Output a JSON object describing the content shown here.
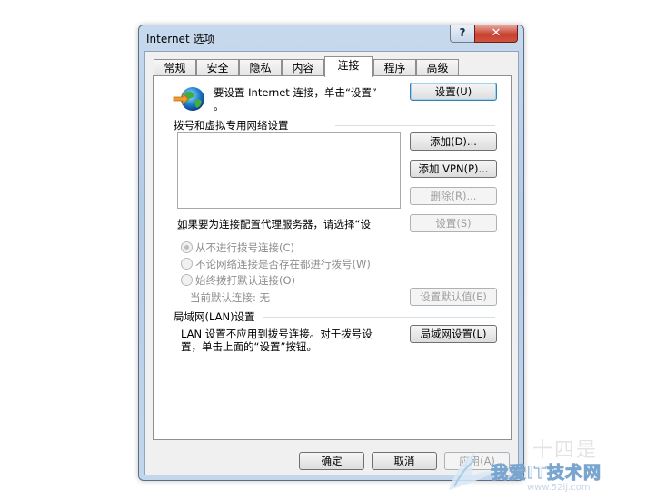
{
  "window": {
    "title": "Internet 选项",
    "help_label": "?",
    "close_label": "✕"
  },
  "tabs": [
    {
      "label": "常规",
      "active": false
    },
    {
      "label": "安全",
      "active": false
    },
    {
      "label": "隐私",
      "active": false
    },
    {
      "label": "内容",
      "active": false
    },
    {
      "label": "连接",
      "active": true
    },
    {
      "label": "程序",
      "active": false
    },
    {
      "label": "高级",
      "active": false
    }
  ],
  "setup": {
    "text_line1": "要设置 Internet 连接，单击“设置”",
    "text_line2": "。",
    "button": "设置(U)"
  },
  "dialup": {
    "heading": "拨号和虚拟专用网络设置",
    "add_button": "添加(D)...",
    "add_vpn_button": "添加 VPN(P)...",
    "delete_button": "删除(R)...",
    "settings_button": "设置(S)",
    "proxy_text": "如果要为连接配置代理服务器，请选择“设",
    "proxy_text_cont": "置”。",
    "radios": [
      {
        "label": "从不进行拨号连接(C)",
        "checked": true
      },
      {
        "label": "不论网络连接是否存在都进行拨号(W)",
        "checked": false
      },
      {
        "label": "始终拨打默认连接(O)",
        "checked": false
      }
    ],
    "current_default": "当前默认连接: 无",
    "set_default_button": "设置默认值(E)"
  },
  "lan": {
    "heading": "局域网(LAN)设置",
    "text_line1": "LAN 设置不应用到拨号连接。对于拨号设",
    "text_line2": "置，单击上面的“设置”按钮。",
    "button": "局域网设置(L)"
  },
  "footer": {
    "ok": "确定",
    "cancel": "取消",
    "apply": "应用(A)"
  },
  "watermark": {
    "brand": "我爱IT技术网",
    "url": "www.52ij.com",
    "faint": "十四是"
  }
}
